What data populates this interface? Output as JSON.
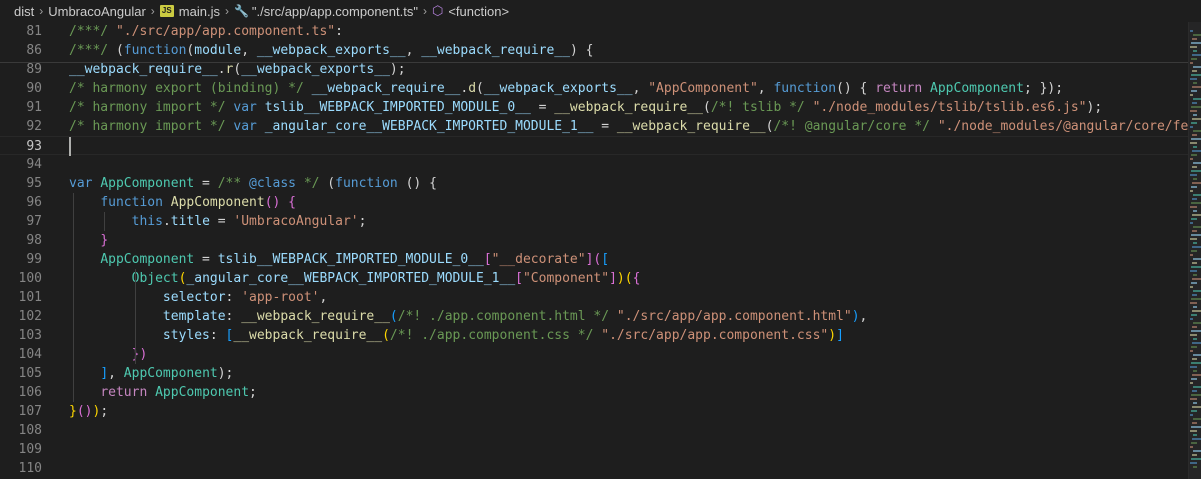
{
  "breadcrumbs": {
    "items": [
      "dist",
      "UmbracoAngular",
      "main.js",
      "\"./src/app/app.component.ts\"",
      "<function>"
    ]
  },
  "icons": {
    "separator": "chevron-right-icon",
    "file": "javascript-file-icon",
    "module": "wrench-icon",
    "function": "cube-icon"
  },
  "colors": {
    "comment": "#6a9955",
    "string": "#ce9178",
    "keyword": "#569cd6",
    "variable": "#9cdcfe",
    "function": "#dcdcaa",
    "class": "#4ec9b0",
    "control": "#c586c0",
    "background": "#1e1e1e",
    "line_number": "#858585"
  },
  "editor": {
    "active_line": "93",
    "lines": [
      {
        "n": "81",
        "tokens": [
          [
            "c",
            "/***/ "
          ],
          [
            "s",
            "\"./src/app/app.component.ts\""
          ],
          [
            "p",
            ":"
          ]
        ]
      },
      {
        "n": "86",
        "tokens": [
          [
            "c",
            "/***/ "
          ],
          [
            "p",
            "("
          ],
          [
            "k",
            "function"
          ],
          [
            "p",
            "("
          ],
          [
            "v",
            "module"
          ],
          [
            "p",
            ", "
          ],
          [
            "v",
            "__webpack_exports__"
          ],
          [
            "p",
            ", "
          ],
          [
            "v",
            "__webpack_require__"
          ],
          [
            "p",
            ") {"
          ]
        ]
      },
      {
        "n": "89",
        "tokens": [
          [
            "v",
            "__webpack_require__"
          ],
          [
            "p",
            "."
          ],
          [
            "f",
            "r"
          ],
          [
            "p",
            "("
          ],
          [
            "v",
            "__webpack_exports__"
          ],
          [
            "p",
            ");"
          ]
        ]
      },
      {
        "n": "90",
        "tokens": [
          [
            "c",
            "/* harmony export (binding) */ "
          ],
          [
            "v",
            "__webpack_require__"
          ],
          [
            "p",
            "."
          ],
          [
            "f",
            "d"
          ],
          [
            "p",
            "("
          ],
          [
            "v",
            "__webpack_exports__"
          ],
          [
            "p",
            ", "
          ],
          [
            "s",
            "\"AppComponent\""
          ],
          [
            "p",
            ", "
          ],
          [
            "k",
            "function"
          ],
          [
            "p",
            "() { "
          ],
          [
            "cf",
            "return"
          ],
          [
            "p",
            " "
          ],
          [
            "t",
            "AppComponent"
          ],
          [
            "p",
            "; });"
          ]
        ]
      },
      {
        "n": "91",
        "tokens": [
          [
            "c",
            "/* harmony import */ "
          ],
          [
            "k",
            "var"
          ],
          [
            "p",
            " "
          ],
          [
            "v",
            "tslib__WEBPACK_IMPORTED_MODULE_0__"
          ],
          [
            "p",
            " = "
          ],
          [
            "f",
            "__webpack_require__"
          ],
          [
            "p",
            "("
          ],
          [
            "c",
            "/*! tslib */"
          ],
          [
            "p",
            " "
          ],
          [
            "s",
            "\"./node_modules/tslib/tslib.es6.js\""
          ],
          [
            "p",
            ");"
          ]
        ]
      },
      {
        "n": "92",
        "tokens": [
          [
            "c",
            "/* harmony import */ "
          ],
          [
            "k",
            "var"
          ],
          [
            "p",
            " "
          ],
          [
            "v",
            "_angular_core__WEBPACK_IMPORTED_MODULE_1__"
          ],
          [
            "p",
            " = "
          ],
          [
            "f",
            "__webpack_require__"
          ],
          [
            "p",
            "("
          ],
          [
            "c",
            "/*! @angular/core */"
          ],
          [
            "p",
            " "
          ],
          [
            "s",
            "\"./node_modules/@angular/core/fesm"
          ]
        ]
      },
      {
        "n": "93",
        "tokens": []
      },
      {
        "n": "94",
        "tokens": []
      },
      {
        "n": "95",
        "tokens": [
          [
            "k",
            "var"
          ],
          [
            "p",
            " "
          ],
          [
            "t",
            "AppComponent"
          ],
          [
            "p",
            " = "
          ],
          [
            "c",
            "/** "
          ],
          [
            "k",
            "@class"
          ],
          [
            "c",
            " */"
          ],
          [
            "p",
            " ("
          ],
          [
            "k",
            "function"
          ],
          [
            "p",
            " () {"
          ]
        ]
      },
      {
        "n": "96",
        "tokens": [
          [
            "p",
            "    "
          ],
          [
            "k",
            "function"
          ],
          [
            "p",
            " "
          ],
          [
            "f",
            "AppComponent"
          ],
          [
            "br2",
            "()"
          ],
          [
            "p",
            " "
          ],
          [
            "br2",
            "{"
          ]
        ]
      },
      {
        "n": "97",
        "tokens": [
          [
            "p",
            "        "
          ],
          [
            "k",
            "this"
          ],
          [
            "p",
            "."
          ],
          [
            "v",
            "title"
          ],
          [
            "p",
            " = "
          ],
          [
            "s",
            "'UmbracoAngular'"
          ],
          [
            "p",
            ";"
          ]
        ]
      },
      {
        "n": "98",
        "tokens": [
          [
            "p",
            "    "
          ],
          [
            "br2",
            "}"
          ]
        ]
      },
      {
        "n": "99",
        "tokens": [
          [
            "p",
            "    "
          ],
          [
            "t",
            "AppComponent"
          ],
          [
            "p",
            " = "
          ],
          [
            "v",
            "tslib__WEBPACK_IMPORTED_MODULE_0__"
          ],
          [
            "br2",
            "["
          ],
          [
            "s",
            "\"__decorate\""
          ],
          [
            "br2",
            "]("
          ],
          [
            "br3",
            "["
          ]
        ]
      },
      {
        "n": "100",
        "tokens": [
          [
            "p",
            "        "
          ],
          [
            "t",
            "Object"
          ],
          [
            "br1",
            "("
          ],
          [
            "v",
            "_angular_core__WEBPACK_IMPORTED_MODULE_1__"
          ],
          [
            "br2",
            "["
          ],
          [
            "s",
            "\"Component\""
          ],
          [
            "br2",
            "]"
          ],
          [
            "br1",
            ")("
          ],
          [
            "br2",
            "{"
          ]
        ]
      },
      {
        "n": "101",
        "tokens": [
          [
            "p",
            "            "
          ],
          [
            "v",
            "selector"
          ],
          [
            "p",
            ": "
          ],
          [
            "s",
            "'app-root'"
          ],
          [
            "p",
            ","
          ]
        ]
      },
      {
        "n": "102",
        "tokens": [
          [
            "p",
            "            "
          ],
          [
            "v",
            "template"
          ],
          [
            "p",
            ": "
          ],
          [
            "f",
            "__webpack_require__"
          ],
          [
            "br3",
            "("
          ],
          [
            "c",
            "/*! ./app.component.html */"
          ],
          [
            "p",
            " "
          ],
          [
            "s",
            "\"./src/app/app.component.html\""
          ],
          [
            "br3",
            ")"
          ],
          [
            "p",
            ","
          ]
        ]
      },
      {
        "n": "103",
        "tokens": [
          [
            "p",
            "            "
          ],
          [
            "v",
            "styles"
          ],
          [
            "p",
            ": "
          ],
          [
            "br3",
            "["
          ],
          [
            "f",
            "__webpack_require__"
          ],
          [
            "br1",
            "("
          ],
          [
            "c",
            "/*! ./app.component.css */"
          ],
          [
            "p",
            " "
          ],
          [
            "s",
            "\"./src/app/app.component.css\""
          ],
          [
            "br1",
            ")"
          ],
          [
            "br3",
            "]"
          ]
        ]
      },
      {
        "n": "104",
        "tokens": [
          [
            "p",
            "        "
          ],
          [
            "br2",
            "})"
          ]
        ]
      },
      {
        "n": "105",
        "tokens": [
          [
            "p",
            "    "
          ],
          [
            "br3",
            "]"
          ],
          [
            "p",
            ", "
          ],
          [
            "t",
            "AppComponent"
          ],
          [
            "p",
            ");"
          ]
        ]
      },
      {
        "n": "106",
        "tokens": [
          [
            "p",
            "    "
          ],
          [
            "cf",
            "return"
          ],
          [
            "p",
            " "
          ],
          [
            "t",
            "AppComponent"
          ],
          [
            "p",
            ";"
          ]
        ]
      },
      {
        "n": "107",
        "tokens": [
          [
            "br1",
            "}"
          ],
          [
            "br2",
            "()"
          ],
          [
            "br1",
            ")"
          ],
          [
            "p",
            ";"
          ]
        ]
      },
      {
        "n": "108",
        "tokens": []
      },
      {
        "n": "109",
        "tokens": []
      },
      {
        "n": "110",
        "tokens": []
      }
    ]
  }
}
